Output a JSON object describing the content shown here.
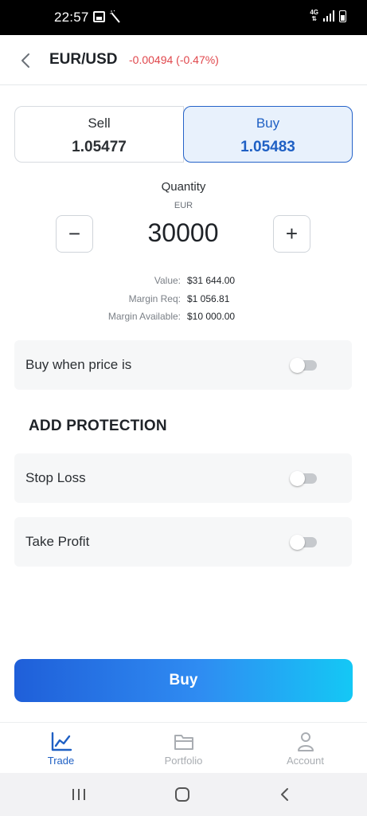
{
  "status_bar": {
    "time": "22:57",
    "network": "4G"
  },
  "header": {
    "pair": "EUR/USD",
    "change": "-0.00494 (-0.47%)"
  },
  "sides": {
    "sell": {
      "label": "Sell",
      "price": "1.05477"
    },
    "buy": {
      "label": "Buy",
      "price": "1.05483"
    }
  },
  "quantity": {
    "label": "Quantity",
    "unit": "EUR",
    "value": "30000",
    "minus": "−",
    "plus": "+"
  },
  "info": [
    {
      "label": "Value:",
      "value": "$31 644.00"
    },
    {
      "label": "Margin Req:",
      "value": "$1 056.81"
    },
    {
      "label": "Margin Available:",
      "value": "$10 000.00"
    }
  ],
  "limit": {
    "label": "Buy when price is",
    "enabled": false
  },
  "protection": {
    "title": "ADD PROTECTION",
    "stop_loss": {
      "label": "Stop Loss",
      "enabled": false
    },
    "take_profit": {
      "label": "Take Profit",
      "enabled": false
    }
  },
  "action_button": "Buy",
  "bottom_nav": [
    {
      "label": "Trade",
      "icon": "chart-line-icon",
      "active": true
    },
    {
      "label": "Portfolio",
      "icon": "folder-icon",
      "active": false
    },
    {
      "label": "Account",
      "icon": "person-icon",
      "active": false
    }
  ],
  "colors": {
    "accent": "#1f60c4",
    "negative": "#e0474c",
    "button_start": "#1f5fd9",
    "button_end": "#14c8f5"
  }
}
